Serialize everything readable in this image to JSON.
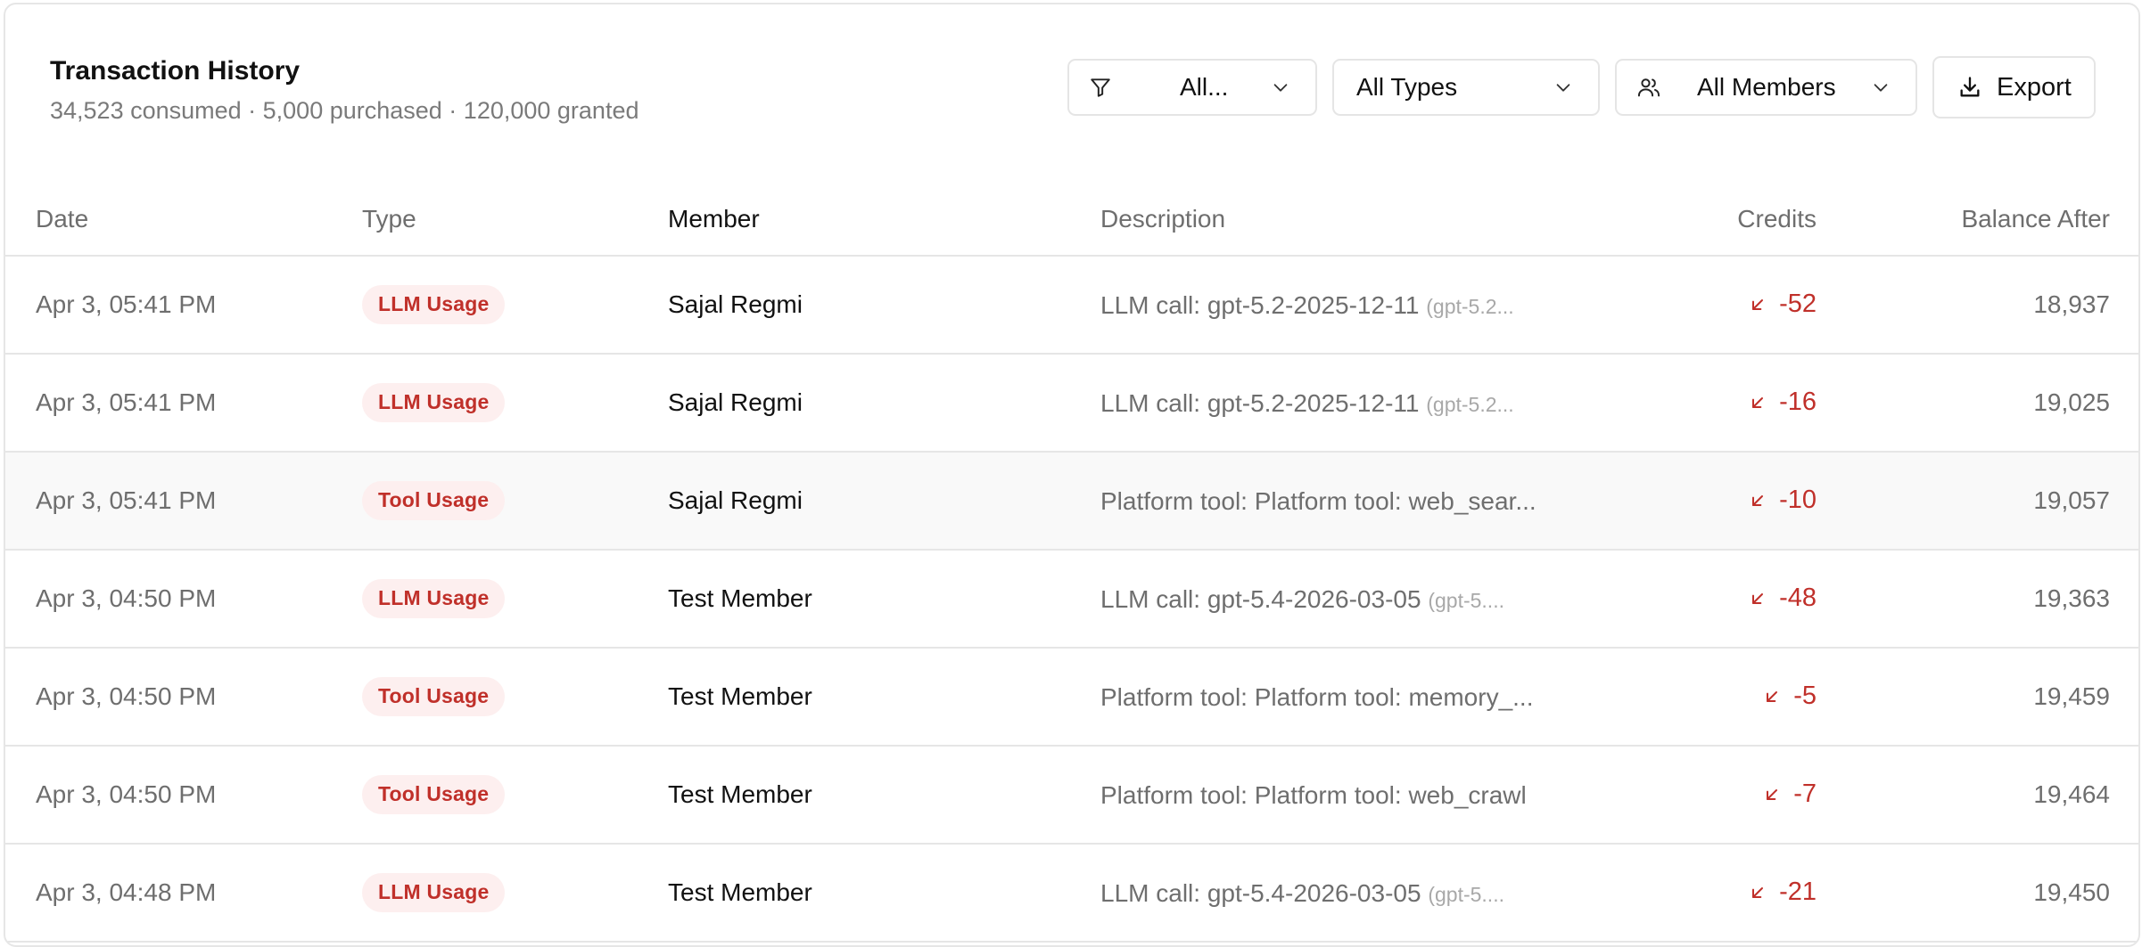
{
  "header": {
    "title": "Transaction History",
    "subtitle": "34,523 consumed · 5,000 purchased · 120,000 granted"
  },
  "controls": {
    "filter_value": "All...",
    "type_value": "All Types",
    "member_value": "All Members",
    "export_label": "Export"
  },
  "columns": {
    "date": "Date",
    "type": "Type",
    "member": "Member",
    "description": "Description",
    "credits": "Credits",
    "balance": "Balance After"
  },
  "colors": {
    "negative": "#c0302a",
    "badge_bg": "#fdefef",
    "muted_text": "#6e6e6e"
  },
  "icons": {
    "filter": "filter-icon",
    "chevron": "chevron-down-icon",
    "members": "users-icon",
    "export": "download-icon",
    "credit_direction": "arrow-down-left-icon"
  },
  "rows": [
    {
      "date": "Apr 3, 05:41 PM",
      "type": "LLM Usage",
      "member": "Sajal Regmi",
      "desc": "LLM call: gpt-5.2-2025-12-11",
      "desc_sub": "(gpt-5.2...",
      "credits": "-52",
      "balance": "18,937"
    },
    {
      "date": "Apr 3, 05:41 PM",
      "type": "LLM Usage",
      "member": "Sajal Regmi",
      "desc": "LLM call: gpt-5.2-2025-12-11",
      "desc_sub": "(gpt-5.2...",
      "credits": "-16",
      "balance": "19,025"
    },
    {
      "date": "Apr 3, 05:41 PM",
      "type": "Tool Usage",
      "member": "Sajal Regmi",
      "desc": "Platform tool: Platform tool: web_sear...",
      "desc_sub": "",
      "credits": "-10",
      "balance": "19,057"
    },
    {
      "date": "Apr 3, 04:50 PM",
      "type": "LLM Usage",
      "member": "Test Member",
      "desc": "LLM call: gpt-5.4-2026-03-05",
      "desc_sub": "(gpt-5....",
      "credits": "-48",
      "balance": "19,363"
    },
    {
      "date": "Apr 3, 04:50 PM",
      "type": "Tool Usage",
      "member": "Test Member",
      "desc": "Platform tool: Platform tool: memory_...",
      "desc_sub": "",
      "credits": "-5",
      "balance": "19,459"
    },
    {
      "date": "Apr 3, 04:50 PM",
      "type": "Tool Usage",
      "member": "Test Member",
      "desc": "Platform tool: Platform tool: web_crawl",
      "desc_sub": "",
      "credits": "-7",
      "balance": "19,464"
    },
    {
      "date": "Apr 3, 04:48 PM",
      "type": "LLM Usage",
      "member": "Test Member",
      "desc": "LLM call: gpt-5.4-2026-03-05",
      "desc_sub": "(gpt-5....",
      "credits": "-21",
      "balance": "19,450"
    }
  ]
}
